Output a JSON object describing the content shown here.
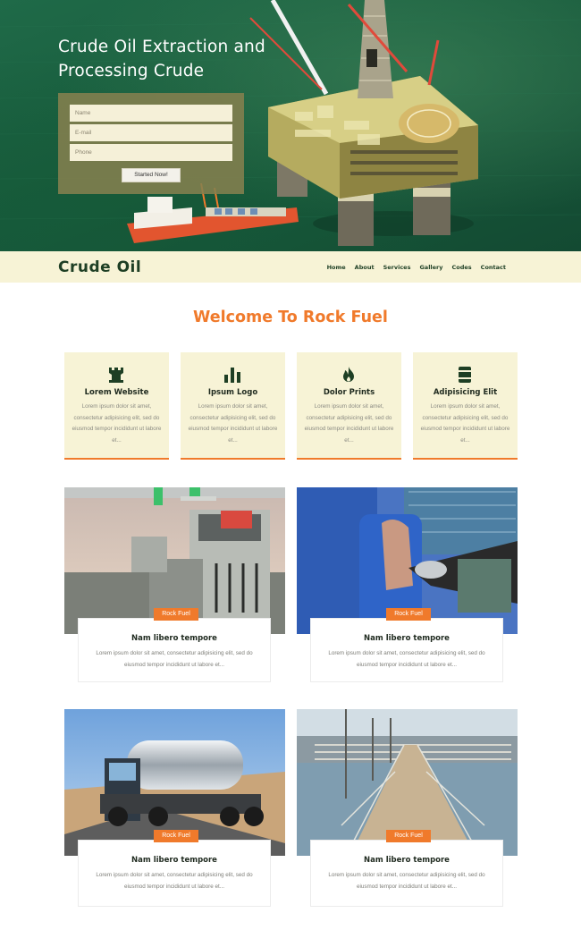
{
  "hero": {
    "title": "Crude Oil Extraction and Processing Crude",
    "form": {
      "name_placeholder": "Name",
      "email_placeholder": "E-mail",
      "phone_placeholder": "Phone",
      "submit_label": "Started Now!"
    }
  },
  "nav": {
    "brand": "Crude Oil",
    "links": [
      "Home",
      "About",
      "Services",
      "Gallery",
      "Codes",
      "Contact"
    ]
  },
  "welcome": {
    "title": "Welcome To Rock Fuel",
    "features": [
      {
        "title": "Lorem Website",
        "text": "Lorem ipsum dolor sit amet, consectetur adipisicing elit, sed do eiusmod tempor incididunt ut labore et...",
        "icon": "rook-icon"
      },
      {
        "title": "Ipsum Logo",
        "text": "Lorem ipsum dolor sit amet, consectetur adipisicing elit, sed do eiusmod tempor incididunt ut labore et...",
        "icon": "bar-chart-icon"
      },
      {
        "title": "Dolor Prints",
        "text": "Lorem ipsum dolor sit amet, consectetur adipisicing elit, sed do eiusmod tempor incididunt ut labore et...",
        "icon": "fire-icon"
      },
      {
        "title": "Adipisicing Elit",
        "text": "Lorem ipsum dolor sit amet, consectetur adipisicing elit, sed do eiusmod tempor incididunt ut labore et...",
        "icon": "barrel-icon"
      }
    ]
  },
  "cards": [
    {
      "badge": "Rock Fuel",
      "title": "Nam libero tempore",
      "text": "Lorem ipsum dolor sit amet, consectetur adipisicing elit, sed do eiusmod tempor incididunt ut labore et..."
    },
    {
      "badge": "Rock Fuel",
      "title": "Nam libero tempore",
      "text": "Lorem ipsum dolor sit amet, consectetur adipisicing elit, sed do eiusmod tempor incididunt ut labore et..."
    },
    {
      "badge": "Rock Fuel",
      "title": "Nam libero tempore",
      "text": "Lorem ipsum dolor sit amet, consectetur adipisicing elit, sed do eiusmod tempor incididunt ut labore et..."
    },
    {
      "badge": "Rock Fuel",
      "title": "Nam libero tempore",
      "text": "Lorem ipsum dolor sit amet, consectetur adipisicing elit, sed do eiusmod tempor incididunt ut labore et..."
    }
  ],
  "colors": {
    "accent": "#f07a2b",
    "brand_dark": "#1e3f24",
    "cream": "#f7f3d6",
    "sea": "#1a5e3f"
  }
}
